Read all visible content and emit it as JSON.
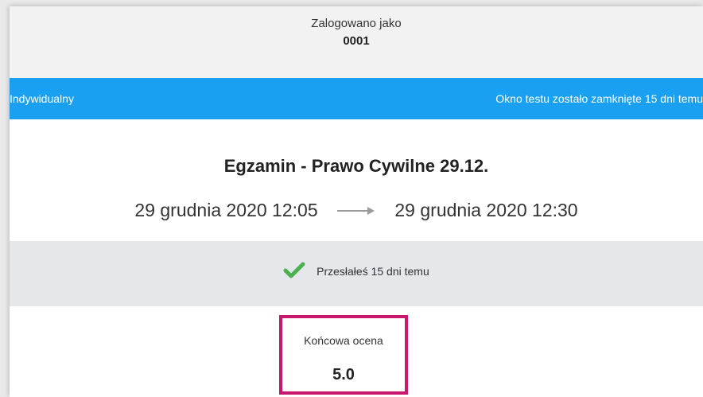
{
  "header": {
    "logged_in_label": "Zalogowano jako",
    "user_id": "0001"
  },
  "bar": {
    "mode": "Indywidualny",
    "window_status": "Okno testu zostało zamknięte 15 dni temu",
    "color": "#1aa0f0"
  },
  "exam": {
    "title": "Egzamin - Prawo Cywilne 29.12.",
    "start": "29 grudnia 2020 12:05",
    "end": "29 grudnia 2020 12:30"
  },
  "submission": {
    "status": "Przesłałeś 15 dni temu",
    "icon": "check-icon",
    "icon_color": "#4caf50"
  },
  "grade": {
    "label": "Końcowa ocena",
    "value": "5.0",
    "highlight_color": "#c8176d"
  }
}
